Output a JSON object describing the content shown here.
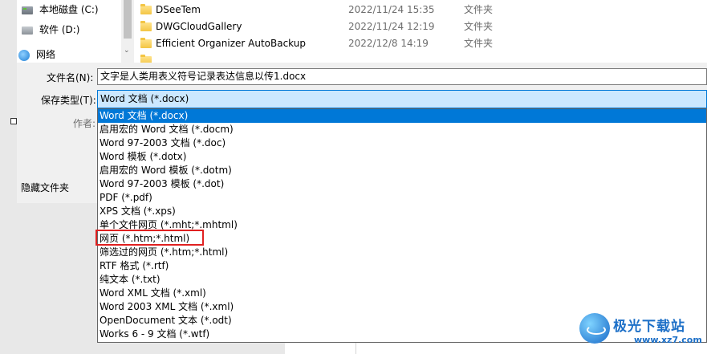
{
  "nav": {
    "items": [
      {
        "label": "本地磁盘 (C:)",
        "icon": "drive-icon"
      },
      {
        "label": "软件 (D:)",
        "icon": "drive-icon"
      },
      {
        "label": "网络",
        "icon": "network-icon"
      }
    ]
  },
  "files": [
    {
      "name": "DSeeTem",
      "date": "2022/11/24 15:35",
      "type": "文件夹"
    },
    {
      "name": "DWGCloudGallery",
      "date": "2022/11/24 12:19",
      "type": "文件夹"
    },
    {
      "name": "Efficient Organizer AutoBackup",
      "date": "2022/12/8 14:19",
      "type": "文件夹"
    }
  ],
  "form": {
    "filename_label": "文件名(N):",
    "filename_value": "文字是人类用表义符号记录表达信息以传1.docx",
    "filetype_label": "保存类型(T):",
    "filetype_value": "Word 文档 (*.docx)",
    "author_label": "作者:",
    "hide_folders_label": "隐藏文件夹"
  },
  "filetype_options": [
    "Word 文档 (*.docx)",
    "启用宏的 Word 文档 (*.docm)",
    "Word 97-2003 文档 (*.doc)",
    "Word 模板 (*.dotx)",
    "启用宏的 Word 模板 (*.dotm)",
    "Word 97-2003 模板 (*.dot)",
    "PDF (*.pdf)",
    "XPS 文档 (*.xps)",
    "单个文件网页 (*.mht;*.mhtml)",
    "网页 (*.htm;*.html)",
    "筛选过的网页 (*.htm;*.html)",
    "RTF 格式 (*.rtf)",
    "纯文本 (*.txt)",
    "Word XML 文档 (*.xml)",
    "Word 2003 XML 文档 (*.xml)",
    "OpenDocument 文本 (*.odt)",
    "Works 6 - 9 文档 (*.wtf)"
  ],
  "selected_option_index": 0,
  "highlighted_option_index": 9,
  "colors": {
    "selection": "#0078d7",
    "highlight_box": "#e02020",
    "watermark": "#1c6fc7"
  },
  "watermark": {
    "title": "极光下载站",
    "url": "www.xz7.com"
  }
}
